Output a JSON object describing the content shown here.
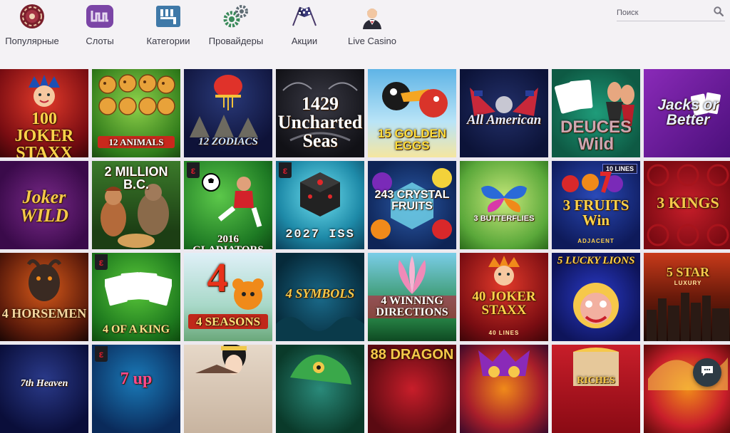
{
  "nav": [
    {
      "label": "Популярные",
      "icon": "popular-chip-icon"
    },
    {
      "label": "Слоты",
      "icon": "slots-icon"
    },
    {
      "label": "Категории",
      "icon": "categories-gear-icon"
    },
    {
      "label": "Провайдеры",
      "icon": "providers-gears-icon"
    },
    {
      "label": "Акции",
      "icon": "promotions-flags-icon"
    },
    {
      "label": "Live Casino",
      "icon": "live-dealer-icon"
    }
  ],
  "search": {
    "placeholder": "Поиск",
    "icon": "search-icon"
  },
  "games": [
    {
      "title": "100 JOKER STAXX"
    },
    {
      "title": "12 ANIMALS"
    },
    {
      "title": "12 ZODIACS"
    },
    {
      "title": "1429 Uncharted Seas"
    },
    {
      "title": "15 GOLDEN EGGS"
    },
    {
      "title": "All American"
    },
    {
      "title": "DEUCES Wild"
    },
    {
      "title": "Jacks or Better"
    },
    {
      "title": "Joker WILD"
    },
    {
      "title": "2 MILLION B.C."
    },
    {
      "title": "2016 GLADIATORS"
    },
    {
      "title": "2027 ISS"
    },
    {
      "title": "243 CRYSTAL FRUITS"
    },
    {
      "title": "3 BUTTERFLIES"
    },
    {
      "title": "3 FRUITS Win",
      "badge": "10 LINES",
      "sub": "ADJACENT"
    },
    {
      "title": "3 KINGS"
    },
    {
      "title": "4 HORSEMEN"
    },
    {
      "title": "4 OF A KING"
    },
    {
      "title": "4 SEASONS"
    },
    {
      "title": "4 SYMBOLS"
    },
    {
      "title": "4 WINNING DIRECTIONS"
    },
    {
      "title": "40 JOKER STAXX",
      "sub": "40 LINES"
    },
    {
      "title": "5 LUCKY LIONS"
    },
    {
      "title": "5 STAR",
      "sub": "LUXURY"
    },
    {
      "title": "7th Heaven"
    },
    {
      "title": "7 up"
    },
    {
      "title": ""
    },
    {
      "title": ""
    },
    {
      "title": "88 DRAGON"
    },
    {
      "title": ""
    },
    {
      "title": "RICHES"
    },
    {
      "title": ""
    }
  ],
  "colors": {
    "accent": "#7a3a9a",
    "chat": "#2d3b45",
    "topbar": "#f4f2f5"
  }
}
